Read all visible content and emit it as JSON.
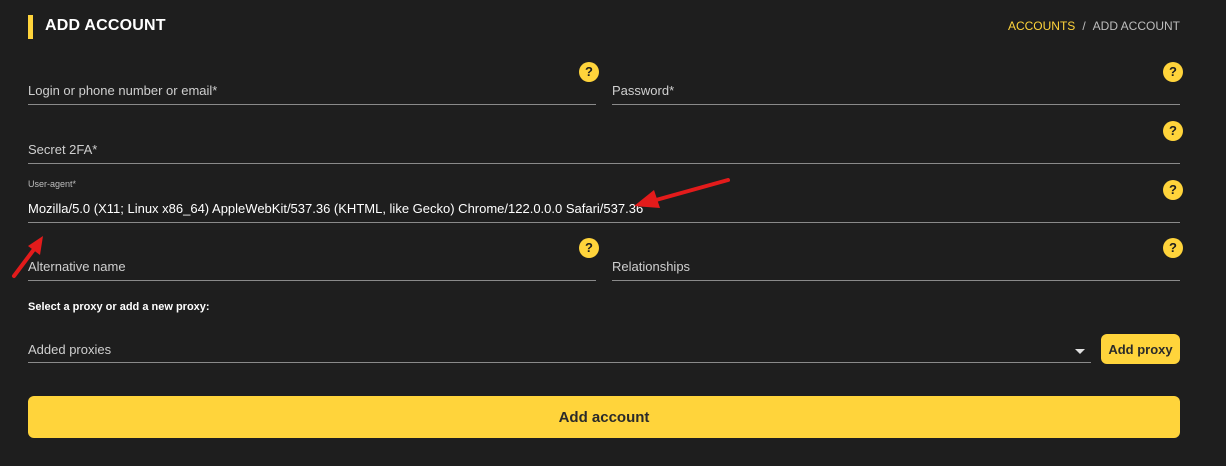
{
  "header": {
    "title": "ADD ACCOUNT",
    "breadcrumb": {
      "link": "ACCOUNTS",
      "separator": "/",
      "current": "ADD ACCOUNT"
    }
  },
  "form": {
    "login_placeholder": "Login or phone number or email*",
    "password_placeholder": "Password*",
    "secret_placeholder": "Secret 2FA*",
    "useragent_label": "User-agent*",
    "useragent_value": "Mozilla/5.0 (X11; Linux x86_64) AppleWebKit/537.36 (KHTML, like Gecko) Chrome/122.0.0.0 Safari/537.36",
    "alt_name_placeholder": "Alternative name",
    "relationships_placeholder": "Relationships",
    "help_glyph": "?",
    "proxy_section_label": "Select a proxy or add a new proxy:",
    "proxy_select_placeholder": "Added proxies",
    "add_proxy_label": "Add proxy",
    "submit_label": "Add account"
  },
  "icons": {
    "help": "question-mark-circle",
    "dropdown": "caret-down",
    "annotation": "red-arrow"
  },
  "colors": {
    "background": "#1e1e1e",
    "accent": "#ffd43b",
    "annotation": "#e31b1b"
  }
}
